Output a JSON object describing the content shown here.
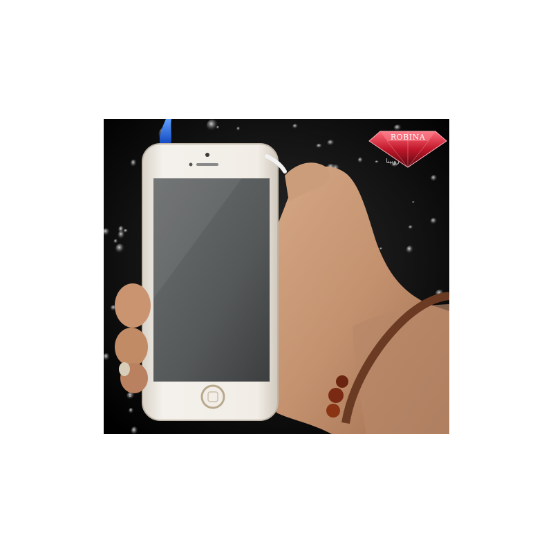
{
  "photo": {
    "background_color": "#0a0a0a",
    "subject": "phone-lighter-in-hand"
  },
  "logo": {
    "brand": "ROBINA",
    "subtitle": "روبينا",
    "gem_color": "#c0182a"
  },
  "colors": {
    "phone_body": "#ece8e2",
    "phone_screen": "#5a5d5e",
    "flame": "#2a63d6",
    "skin": "#c99a78",
    "bracelet": "#6b3a22"
  }
}
